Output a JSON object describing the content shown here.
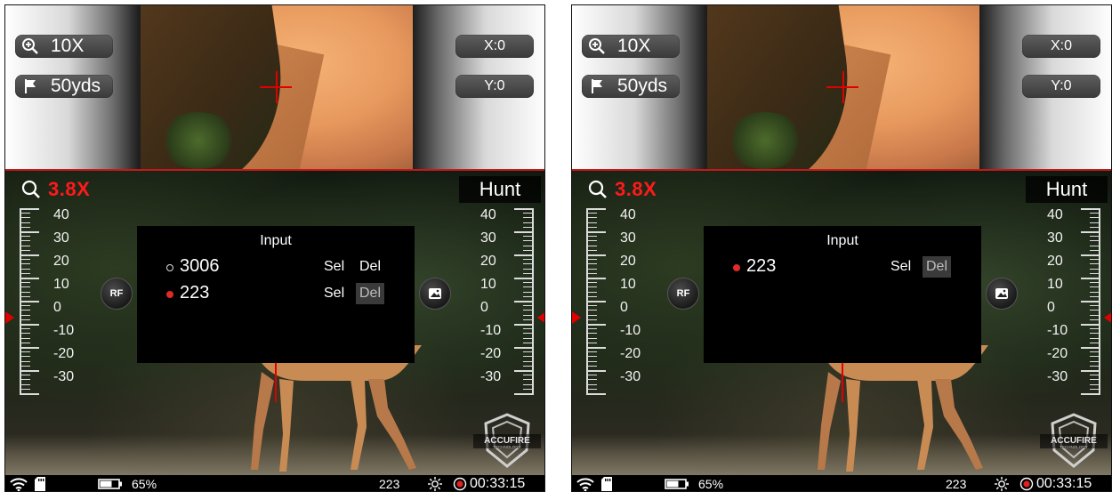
{
  "screens": [
    {
      "zoom_window": {
        "magnification": "10X",
        "distance": "50yds",
        "x_offset": "X:0",
        "y_offset": "Y:0"
      },
      "main": {
        "magnification": "3.8X",
        "mode": "Hunt",
        "scale_labels": [
          "40",
          "30",
          "20",
          "10",
          "0",
          "-10",
          "-20",
          "-30"
        ],
        "rf_label": "RF"
      },
      "dialog": {
        "title": "Input",
        "rows": [
          {
            "name": "3006",
            "selected": false,
            "sel_label": "Sel",
            "del_label": "Del",
            "del_highlighted": false
          },
          {
            "name": "223",
            "selected": true,
            "sel_label": "Sel",
            "del_label": "Del",
            "del_highlighted": true
          }
        ]
      },
      "status": {
        "battery": "65%",
        "profile": "223",
        "time": "00:33:15"
      },
      "logo": {
        "line1": "ACCUFIRE",
        "line2": "TECHNOLOGY"
      }
    },
    {
      "zoom_window": {
        "magnification": "10X",
        "distance": "50yds",
        "x_offset": "X:0",
        "y_offset": "Y:0"
      },
      "main": {
        "magnification": "3.8X",
        "mode": "Hunt",
        "scale_labels": [
          "40",
          "30",
          "20",
          "10",
          "0",
          "-10",
          "-20",
          "-30"
        ],
        "rf_label": "RF"
      },
      "dialog": {
        "title": "Input",
        "rows": [
          {
            "name": "223",
            "selected": true,
            "sel_label": "Sel",
            "del_label": "Del",
            "del_highlighted": true
          }
        ]
      },
      "status": {
        "battery": "65%",
        "profile": "223",
        "time": "00:33:15"
      },
      "logo": {
        "line1": "ACCUFIRE",
        "line2": "TECHNOLOGY"
      }
    }
  ],
  "colors": {
    "accent_red": "#e00000",
    "magnification_red": "#ff1a1a",
    "dialog_bg": "#000000",
    "highlight_bg": "#3a3a3a"
  }
}
